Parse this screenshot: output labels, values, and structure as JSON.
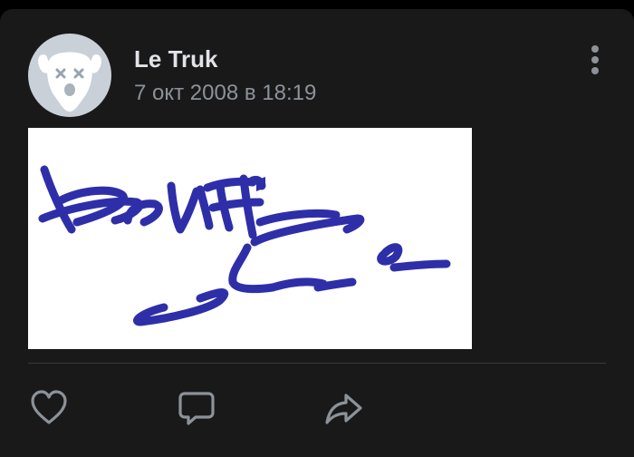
{
  "post": {
    "author": "Le Truk",
    "date": "7 окт 2008 в 18:19",
    "avatar_icon": "vk-dog-avatar-icon",
    "photo_kind": "handwritten-signature",
    "menu_icon": "more-vertical-icon"
  },
  "actions": {
    "like_icon": "heart-icon",
    "comment_icon": "comment-icon",
    "share_icon": "share-icon"
  },
  "colors": {
    "background": "#000000",
    "card": "#191919",
    "text_primary": "#e1e3e6",
    "text_secondary": "#8d9299",
    "icon": "#8d9299",
    "divider": "#3a3b3d",
    "avatar_bg": "#c9d0d8",
    "signature_ink": "#2e2fa8"
  }
}
